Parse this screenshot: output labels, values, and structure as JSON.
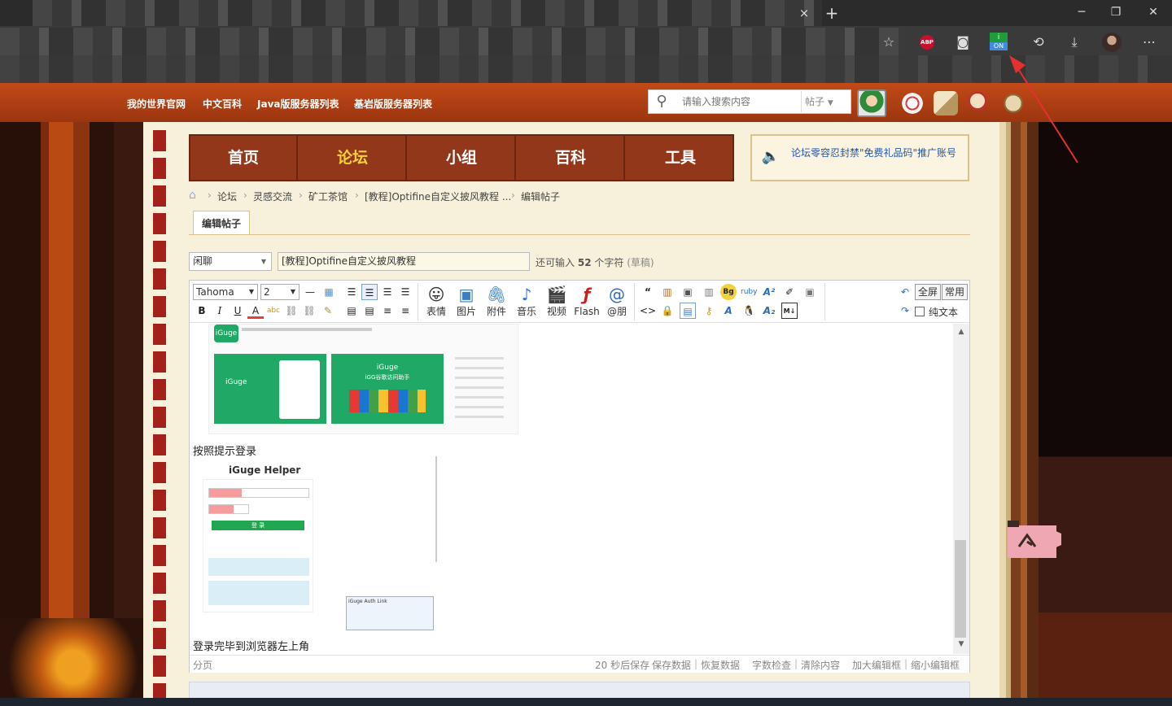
{
  "browser": {
    "tab_close": "×",
    "new_tab": "+",
    "window": {
      "minimize": "─",
      "restore": "❐",
      "close": "✕"
    },
    "extensions": {
      "abp": "ABP",
      "iguge_top": "i",
      "iguge_bottom": "ON"
    },
    "toolbar_icons": [
      "favorites-add-icon",
      "abp-icon",
      "reading-icon",
      "iguge-icon",
      "history-icon",
      "download-icon",
      "profile-icon",
      "more-icon"
    ]
  },
  "site_nav": {
    "links": [
      "我的世界官网",
      "中文百科",
      "Java版服务器列表",
      "基岩版服务器列表"
    ],
    "search_placeholder": "请输入搜索内容",
    "search_type": "帖子"
  },
  "main_nav": {
    "items": [
      "首页",
      "论坛",
      "小组",
      "百科",
      "工具"
    ],
    "active": "论坛"
  },
  "notice": "论坛零容忍封禁\"免费礼品码\"推广账号",
  "breadcrumb": [
    "论坛",
    "灵感交流",
    "矿工茶馆",
    "[教程]Optifine自定义披风教程 ...",
    "编辑帖子"
  ],
  "tab": "编辑帖子",
  "post": {
    "type": "闲聊",
    "title": "[教程]Optifine自定义披风教程",
    "remain_prefix": "还可输入",
    "remain_count": "52",
    "remain_suffix": "个字符",
    "remain_draft": "(草稿)"
  },
  "editor": {
    "font": "Tahoma",
    "size": "2",
    "format_buttons": {
      "bold": "B",
      "italic": "I",
      "underline": "U",
      "color": "A",
      "hr": "—",
      "code": "<>",
      "quote": "“"
    },
    "big_buttons": [
      "表情",
      "图片",
      "附件",
      "音乐",
      "视频",
      "Flash",
      "@朋"
    ],
    "fullscreen": "全屏",
    "common": "常用",
    "plaintext": "纯文本",
    "content": {
      "line1": "按照提示登录",
      "line2": "登录完毕到浏览器左上角",
      "img1": {
        "brand": "iGuge",
        "card_title": "iGuge",
        "card_sub": "iGG谷歌访问助手"
      },
      "img2": {
        "title": "iGuge Helper",
        "button": "登 录",
        "popup": "iGuge Auth Link"
      }
    },
    "status": {
      "left": "分页",
      "autosave": "20 秒后保存",
      "links": [
        "保存数据",
        "恢复数据",
        "字数检查",
        "清除内容",
        "加大编辑框",
        "缩小编辑框"
      ]
    }
  },
  "colors": {
    "nav": "#93371a",
    "sitebar": "#b2420f",
    "accent": "#f2d23a",
    "frame": "#f7f0da"
  }
}
